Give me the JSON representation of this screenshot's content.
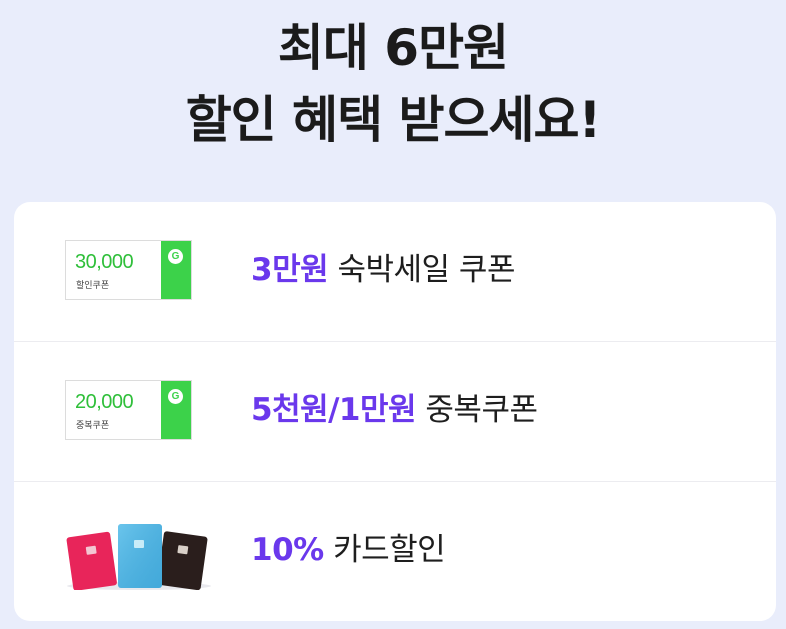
{
  "headline": {
    "line1": "최대 6만원",
    "line2": "할인 혜택 받으세요!"
  },
  "benefits": [
    {
      "coupon_amount": "30,000",
      "coupon_label": "할인쿠폰",
      "coupon_badge": "G",
      "highlight": "3만원",
      "text": "숙박세일 쿠폰"
    },
    {
      "coupon_amount": "20,000",
      "coupon_label": "중복쿠폰",
      "coupon_badge": "G",
      "highlight": "5천원/1만원",
      "text": "중복쿠폰"
    },
    {
      "image": "credit-cards-icon",
      "highlight": "10%",
      "text": "카드할인"
    }
  ],
  "colors": {
    "background": "#e9edfb",
    "accent": "#6a38ec",
    "coupon_green": "#3cd24a",
    "card_pink": "#e8255a",
    "card_blue": "#4cb5e4",
    "card_black": "#2a1e1c"
  }
}
